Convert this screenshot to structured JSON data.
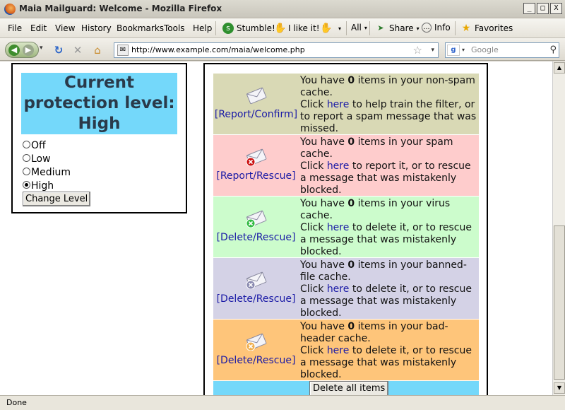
{
  "window": {
    "title": "Maia Mailguard: Welcome - Mozilla Firefox",
    "controls": [
      "_",
      "□",
      "X"
    ]
  },
  "menu": {
    "items": [
      "File",
      "Edit",
      "View",
      "History",
      "Bookmarks",
      "Tools",
      "Help"
    ],
    "stumble_label": "Stumble!",
    "like_label": "I like it!",
    "all_label": "All",
    "share_label": "Share",
    "info_label": "Info",
    "favorites_label": "Favorites"
  },
  "nav": {
    "url": "http://www.example.com/maia/welcome.php",
    "search_placeholder": "Google"
  },
  "protection": {
    "heading": "Current protection level: High",
    "options": [
      {
        "label": "Off",
        "checked": false
      },
      {
        "label": "Low",
        "checked": false
      },
      {
        "label": "Medium",
        "checked": false
      },
      {
        "label": "High",
        "checked": true
      }
    ],
    "change_button": "Change Level"
  },
  "caches": [
    {
      "action": "[Report/Confirm]",
      "color": "#d9d9b5",
      "badge": "none",
      "count": "0",
      "prefix": "You have ",
      "suffix": " items in your non-spam cache.",
      "click": "Click ",
      "here": "here",
      "tail": " to help train the filter, or to report a spam message that was missed."
    },
    {
      "action": "[Report/Rescue]",
      "color": "#fecccc",
      "badge": "red-x",
      "count": "0",
      "prefix": "You have ",
      "suffix": " items in your spam cache.",
      "click": "Click ",
      "here": "here",
      "tail": " to report it, or to rescue a message that was mistakenly blocked."
    },
    {
      "action": "[Delete/Rescue]",
      "color": "#ccfccc",
      "badge": "green-x",
      "count": "0",
      "prefix": "You have ",
      "suffix": " items in your virus cache.",
      "click": "Click ",
      "here": "here",
      "tail": " to delete it, or to rescue a message that was mistakenly blocked."
    },
    {
      "action": "[Delete/Rescue]",
      "color": "#d4d2e6",
      "badge": "gray-x",
      "count": "0",
      "prefix": "You have ",
      "suffix": " items in your banned-file cache.",
      "click": "Click ",
      "here": "here",
      "tail": " to delete it, or to rescue a message that was mistakenly blocked."
    },
    {
      "action": "[Delete/Rescue]",
      "color": "#fec57a",
      "badge": "orange-x",
      "count": "0",
      "prefix": "You have ",
      "suffix": " items in your bad-header cache.",
      "click": "Click ",
      "here": "here",
      "tail": " to delete it, or to rescue a message that was mistakenly blocked."
    }
  ],
  "delete_all": "Delete all items",
  "status": "Done"
}
